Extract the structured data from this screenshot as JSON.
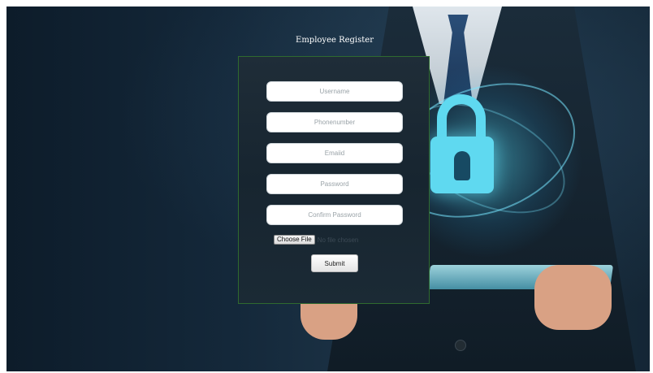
{
  "form": {
    "title": "Employee Register",
    "fields": {
      "username_placeholder": "Username",
      "phone_placeholder": "Phonenumber",
      "email_placeholder": "Emaiid",
      "password_placeholder": "Password",
      "confirm_password_placeholder": "Confirm Password"
    },
    "file": {
      "button_label": "Choose File",
      "status_text": "No file chosen"
    },
    "submit_label": "Submit"
  },
  "background": {
    "image_subject": "businessman-with-security-lock",
    "accent_color": "#5fd9f0"
  }
}
